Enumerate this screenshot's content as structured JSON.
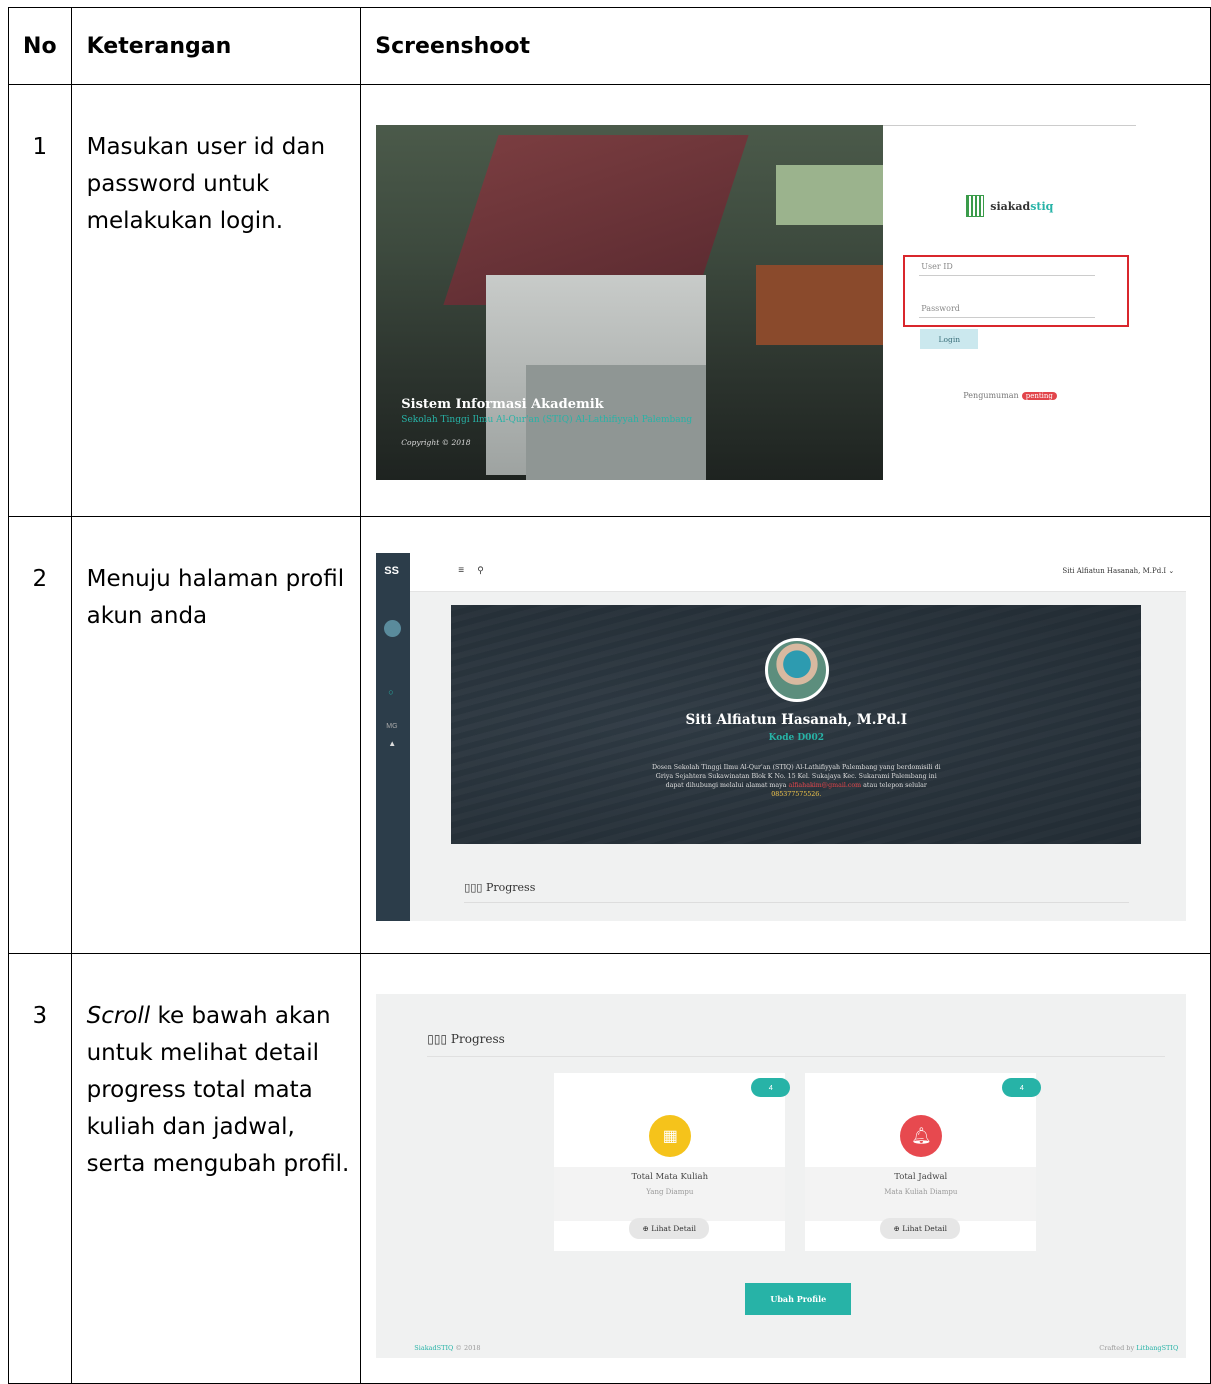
{
  "table": {
    "headers": [
      "No",
      "Keterangan",
      "Screenshoot"
    ],
    "rows": [
      {
        "no": "1",
        "text": "Masukan user id dan password untuk melakukan login."
      },
      {
        "no": "2",
        "text": "Menuju halaman profil akun anda"
      },
      {
        "no": "3",
        "text_em": "Scroll",
        "text": " ke bawah akan untuk melihat detail progress total mata kuliah dan jadwal, serta mengubah profil."
      }
    ]
  },
  "login": {
    "title": "Sistem Informasi Akademik",
    "subtitle": "Sekolah Tinggi Ilmu Al-Qur'an (STIQ) Al-Lathifiyyah Palembang",
    "copyright": "Copyright © 2018",
    "brand_a": "siakad",
    "brand_b": "stiq",
    "user_placeholder": "User ID",
    "password_placeholder": "Password",
    "login_button": "Login",
    "announcement": "Pengumuman",
    "announcement_tag": "penting"
  },
  "profile": {
    "brand": "SS",
    "user_menu": "Siti Alfiatun Hasanah, M.Pd.I ⌄",
    "sidebar_mg": "MG",
    "name": "Siti Alfiatun Hasanah, M.Pd.I",
    "kode_label": "Kode",
    "kode": "D002",
    "desc": "Dosen Sekolah Tinggi Ilmu Al-Qur'an (STIQ) Al-Lathifiyyah Palembang yang berdomisili di Griya Sejahtera Sukawinatan Blok K No. 15 Kel. Sukajaya Kec. Sukarami Palembang ini dapat dihubungi melalui alamat maya",
    "email": "alfiahakim@gmail.com",
    "desc_tail": " atau telepon selular ",
    "phone": "085377575526.",
    "progress": "Progress"
  },
  "progress": {
    "title": "Progress",
    "cards": [
      {
        "count": "4",
        "title": "Total Mata Kuliah",
        "sub": "Yang Diampu",
        "detail": "Lihat Detail",
        "color": "#f5c31b"
      },
      {
        "count": "4",
        "title": "Total Jadwal",
        "sub": "Mata Kuliah Diampu",
        "detail": "Lihat Detail",
        "color": "#e7494f"
      }
    ],
    "edit_button": "Ubah Profile",
    "footer_left_a": "SiakadSTIQ",
    "footer_left_b": " © 2018",
    "footer_right_a": "Crafted by ",
    "footer_right_b": "LitbangSTIQ"
  }
}
